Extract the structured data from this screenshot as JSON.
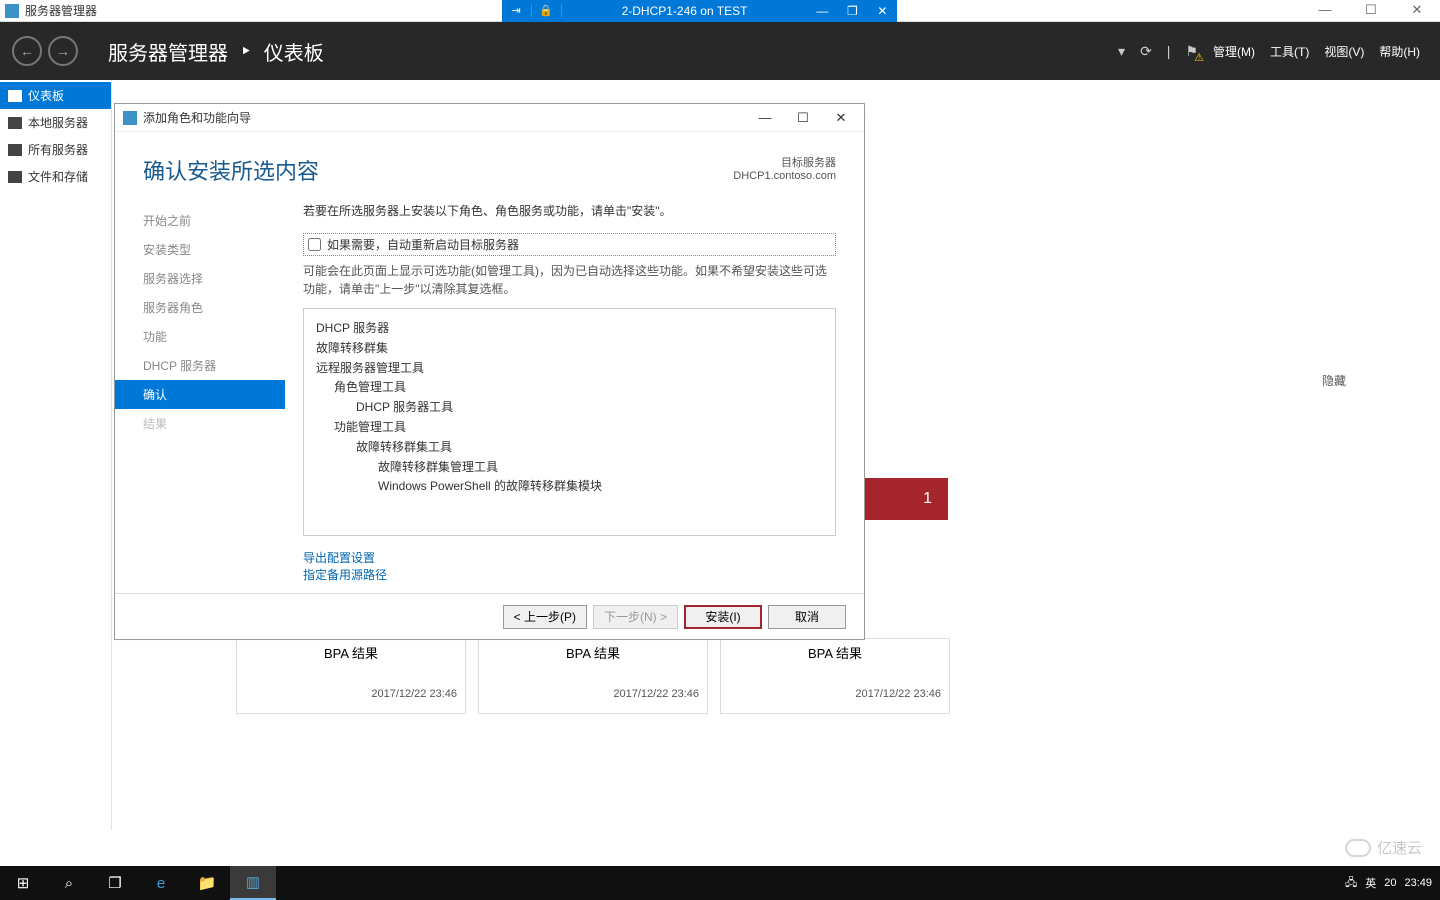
{
  "vm": {
    "app_title": "服务器管理器",
    "center_title": "2-DHCP1-246 on TEST"
  },
  "header": {
    "breadcrumb_root": "服务器管理器",
    "breadcrumb_sep": "•",
    "breadcrumb_current": "仪表板",
    "menu": {
      "manage": "管理(M)",
      "tools": "工具(T)",
      "view": "视图(V)",
      "help": "帮助(H)"
    }
  },
  "leftnav": {
    "dashboard": "仪表板",
    "local": "本地服务器",
    "all": "所有服务器",
    "files": "文件和存储"
  },
  "bg": {
    "bpa": "BPA 结果",
    "timestamp": "2017/12/22 23:46",
    "hide": "隐藏",
    "badge": "1"
  },
  "wizard": {
    "title": "添加角色和功能向导",
    "heading": "确认安装所选内容",
    "target_label": "目标服务器",
    "target_server": "DHCP1.contoso.com",
    "steps": {
      "before": "开始之前",
      "type": "安装类型",
      "server": "服务器选择",
      "roles": "服务器角色",
      "features": "功能",
      "dhcp": "DHCP 服务器",
      "confirm": "确认",
      "result": "结果"
    },
    "intro": "若要在所选服务器上安装以下角色、角色服务或功能，请单击\"安装\"。",
    "checkbox": "如果需要，自动重新启动目标服务器",
    "desc": "可能会在此页面上显示可选功能(如管理工具)，因为已自动选择这些功能。如果不希望安装这些可选功能，请单击\"上一步\"以清除其复选框。",
    "features_list": {
      "l1": "DHCP 服务器",
      "l2": "故障转移群集",
      "l3": "远程服务器管理工具",
      "l4": "角色管理工具",
      "l5": "DHCP 服务器工具",
      "l6": "功能管理工具",
      "l7": "故障转移群集工具",
      "l8": "故障转移群集管理工具",
      "l9": "Windows PowerShell 的故障转移群集模块"
    },
    "links": {
      "export": "导出配置设置",
      "altsrc": "指定备用源路径"
    },
    "buttons": {
      "prev": "< 上一步(P)",
      "next": "下一步(N) >",
      "install": "安装(I)",
      "cancel": "取消"
    }
  },
  "taskbar": {
    "ime": "英",
    "temp": "20",
    "time": "23:49"
  },
  "watermark": "亿速云"
}
